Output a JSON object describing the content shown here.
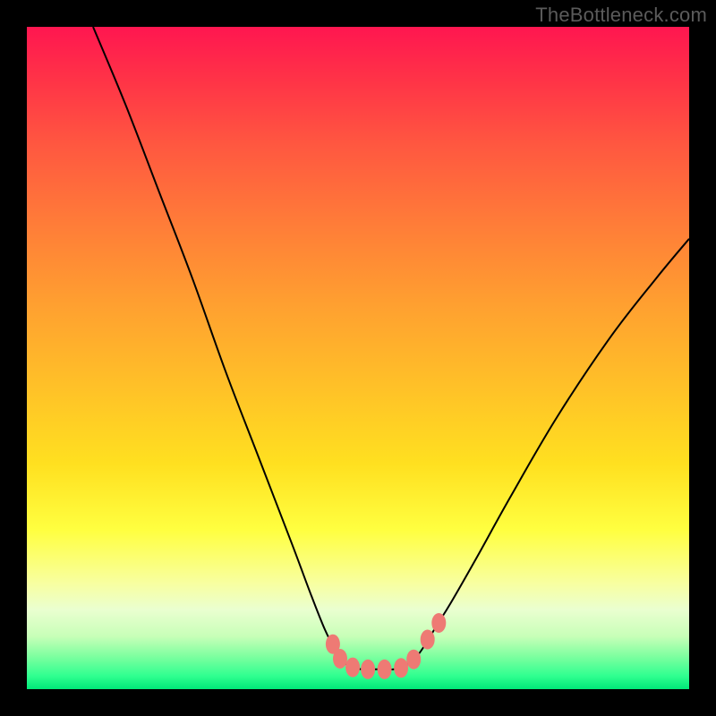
{
  "watermark": "TheBottleneck.com",
  "colors": {
    "frame": "#000000",
    "marker": "#ee7a74",
    "curve": "#000000",
    "gradient_top": "#ff1650",
    "gradient_bottom": "#00e878"
  },
  "chart_data": {
    "type": "line",
    "title": "",
    "xlabel": "",
    "ylabel": "",
    "xlim": [
      0,
      100
    ],
    "ylim": [
      0,
      100
    ],
    "grid": false,
    "legend": false,
    "curve": [
      {
        "x": 10,
        "y": 100
      },
      {
        "x": 15,
        "y": 88
      },
      {
        "x": 20,
        "y": 75
      },
      {
        "x": 25,
        "y": 62
      },
      {
        "x": 30,
        "y": 48
      },
      {
        "x": 35,
        "y": 35
      },
      {
        "x": 40,
        "y": 22
      },
      {
        "x": 43,
        "y": 14
      },
      {
        "x": 45,
        "y": 9
      },
      {
        "x": 46.5,
        "y": 6
      },
      {
        "x": 47.5,
        "y": 4.3
      },
      {
        "x": 49,
        "y": 3.4
      },
      {
        "x": 50.5,
        "y": 3
      },
      {
        "x": 53,
        "y": 3
      },
      {
        "x": 55.5,
        "y": 3
      },
      {
        "x": 57,
        "y": 3.5
      },
      {
        "x": 58.5,
        "y": 4.5
      },
      {
        "x": 60,
        "y": 6.5
      },
      {
        "x": 62,
        "y": 9.8
      },
      {
        "x": 64,
        "y": 13
      },
      {
        "x": 68,
        "y": 20
      },
      {
        "x": 73,
        "y": 29
      },
      {
        "x": 80,
        "y": 41
      },
      {
        "x": 88,
        "y": 53
      },
      {
        "x": 95,
        "y": 62
      },
      {
        "x": 100,
        "y": 68
      }
    ],
    "markers": [
      {
        "x": 46.2,
        "y": 6.8
      },
      {
        "x": 47.3,
        "y": 4.6
      },
      {
        "x": 49.2,
        "y": 3.3
      },
      {
        "x": 51.5,
        "y": 3
      },
      {
        "x": 54,
        "y": 3
      },
      {
        "x": 56.5,
        "y": 3.2
      },
      {
        "x": 58.4,
        "y": 4.5
      },
      {
        "x": 60.5,
        "y": 7.5
      },
      {
        "x": 62.2,
        "y": 10
      }
    ]
  }
}
